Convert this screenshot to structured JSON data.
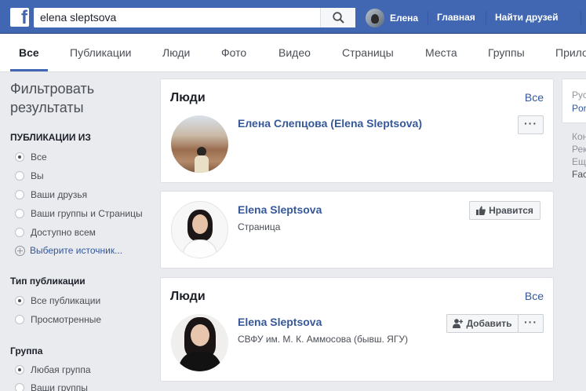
{
  "header": {
    "search_value": "elena sleptsova",
    "user_name": "Елена",
    "nav": [
      "Главная",
      "Найти друзей",
      "Со"
    ]
  },
  "tabs": [
    "Все",
    "Публикации",
    "Люди",
    "Фото",
    "Видео",
    "Страницы",
    "Места",
    "Группы",
    "Прило"
  ],
  "filters": {
    "title": "Фильтровать результаты",
    "posts_from": {
      "heading": "ПУБЛИКАЦИИ ИЗ",
      "options": [
        "Все",
        "Вы",
        "Ваши друзья",
        "Ваши группы и Страницы",
        "Доступно всем"
      ],
      "choose_source": "Выберите источник..."
    },
    "post_type": {
      "heading": "Тип публикации",
      "options": [
        "Все публикации",
        "Просмотренные"
      ]
    },
    "group": {
      "heading": "Группа",
      "options": [
        "Любая группа",
        "Ваши группы"
      ]
    }
  },
  "results": {
    "card1": {
      "title": "Люди",
      "see_all": "Все",
      "name": "Елена Слепцова (Elena Sleptsova)",
      "more": "···"
    },
    "card2": {
      "name": "Elena Sleptsova",
      "subtitle": "Страница",
      "like_label": "Нравится"
    },
    "card3": {
      "title": "Люди",
      "see_all": "Все",
      "name": "Elena Sleptsova",
      "subtitle": "СВФУ им. М. К. Аммосова (бывш. ЯГУ)",
      "add_label": "Добавить",
      "more": "···"
    }
  },
  "right_column": {
    "lang_current": "Рус",
    "lang_other": "Por",
    "footer": [
      "Кон",
      "Рек",
      "Ещ",
      "Fac"
    ]
  },
  "colors": {
    "brand_blue": "#4267b2",
    "link_blue": "#365899",
    "background": "#e9ebee"
  }
}
